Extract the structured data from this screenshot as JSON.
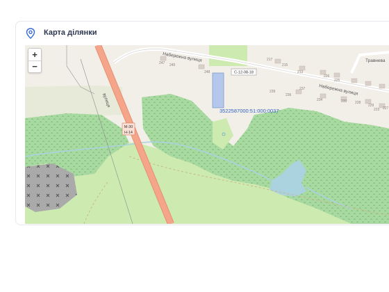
{
  "card": {
    "title": "Карта ділянки",
    "pin_icon": "location-pin-icon"
  },
  "map": {
    "zoom_in_label": "+",
    "zoom_out_label": "−",
    "parcel_label": "3522587000:51:000:0037",
    "road_sign": "С-12-08-18",
    "highway_badge": [
      "М-30",
      "Н-14"
    ],
    "streets": {
      "naberezhna_1": "Набережна вулиця",
      "naberezhna_2": "Набережна вулиця",
      "traveva": "Травнева",
      "side_street": "вулиця"
    },
    "house_numbers": [
      "247",
      "248",
      "245",
      "217",
      "215",
      "213",
      "226",
      "225",
      "239",
      "236",
      "230",
      "234",
      "237",
      "228",
      "229",
      "223",
      "227"
    ],
    "colors": {
      "forest": "#a8d9a0",
      "meadow": "#cdebb0",
      "highway": "#f4a58a",
      "water": "#aad3df",
      "parcel": "#b3c8ec",
      "quarry": "#aaaaaa"
    }
  }
}
